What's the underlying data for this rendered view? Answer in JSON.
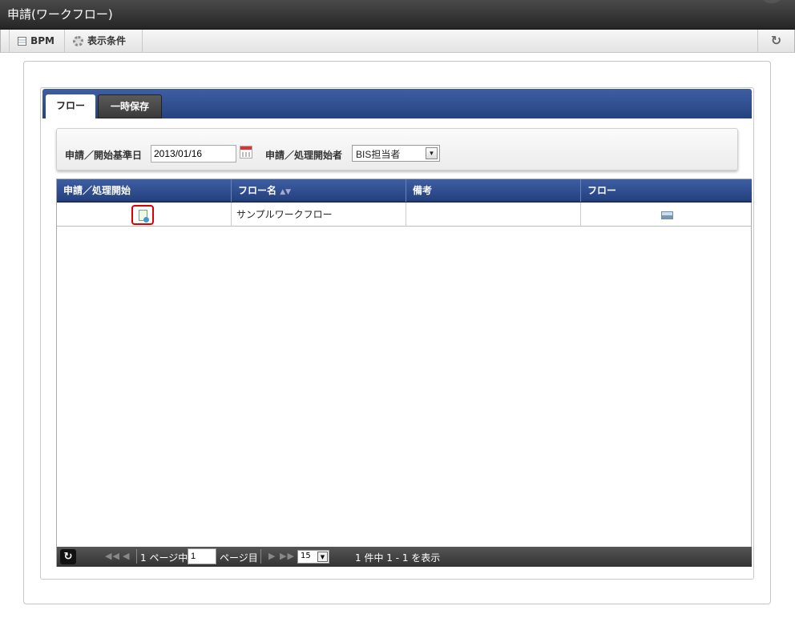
{
  "window": {
    "title": "申請(ワークフロー)"
  },
  "toolbar": {
    "bpm_label": "BPM",
    "bpm_icon": "bpm-list-icon",
    "conditions_label": "表示条件",
    "conditions_icon": "gear-icon",
    "refresh_icon": "refresh-icon"
  },
  "tabs": [
    {
      "label": "フロー",
      "active": true
    },
    {
      "label": "一時保存",
      "active": false
    }
  ],
  "search": {
    "date_label": "申請／開始基準日",
    "date_value": "2013/01/16",
    "actor_label": "申請／処理開始者",
    "actor_value": "BIS担当者"
  },
  "grid": {
    "columns": [
      "申請／処理開始",
      "フロー名",
      "備考",
      "フロー"
    ],
    "sort_indicator": "▲▼",
    "rows": [
      {
        "start_icon": "application-clipboard-icon",
        "flow_name": "サンプルワークフロー",
        "remarks": "",
        "flow_icon": "flow-image-icon"
      }
    ]
  },
  "pager": {
    "page_prefix": "1 ページ中",
    "page_value": "1",
    "page_suffix": "ページ目",
    "page_size": "15",
    "info": "1 件中 1 - 1 を表示"
  },
  "colors": {
    "header_blue": "#2f4d8f",
    "title_bg": "#333333",
    "highlight_red": "#dd0000"
  }
}
